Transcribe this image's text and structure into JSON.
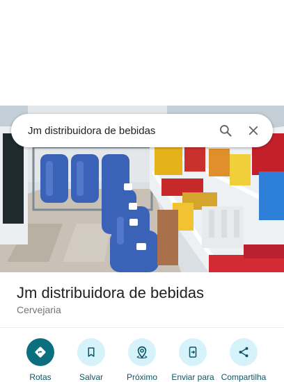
{
  "search": {
    "query": "Jm distribuidora de bebidas"
  },
  "place": {
    "name": "Jm distribuidora de bebidas",
    "category": "Cervejaria",
    "photo_icon": "store-photo"
  },
  "actions": [
    {
      "label": "Rotas",
      "icon": "directions-icon"
    },
    {
      "label": "Salvar",
      "icon": "bookmark-icon"
    },
    {
      "label": "Próximo",
      "icon": "nearby-icon"
    },
    {
      "label": "Enviar para",
      "icon": "send-to-phone-icon"
    },
    {
      "label": "Compartilha",
      "icon": "share-icon"
    }
  ],
  "colors": {
    "primary": "#0b6f80",
    "tonal": "#d6f2fb",
    "label": "#0b5563"
  }
}
